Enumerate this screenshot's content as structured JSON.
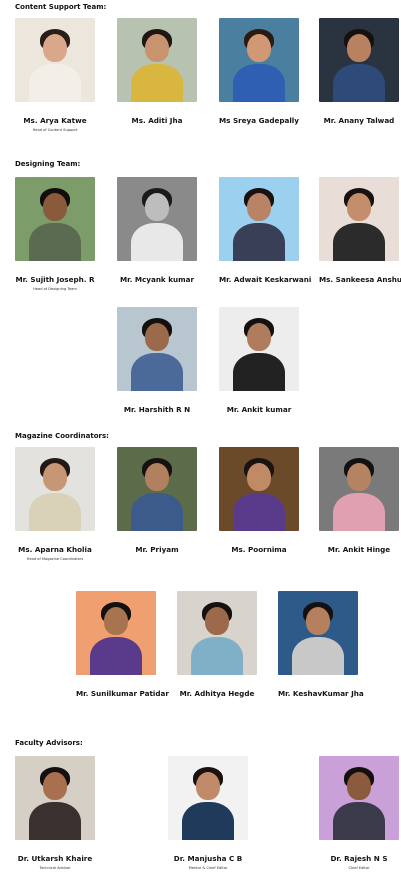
{
  "sections": {
    "content_support": {
      "title": "Content Support Team:",
      "members": [
        {
          "name": "Ms. Arya Katwe",
          "role": "Head of Content Support",
          "bg": "#ece6dd",
          "skin": "#d9a88b",
          "hair": "#2a1c16",
          "shirt": "#f2efe9"
        },
        {
          "name": "Ms. Aditi Jha",
          "role": "",
          "bg": "#b7c2b0",
          "skin": "#c8946f",
          "hair": "#1e1713",
          "shirt": "#d9b640"
        },
        {
          "name": "Ms Sreya Gadepally",
          "role": "",
          "bg": "#4a7fa0",
          "skin": "#d09874",
          "hair": "#2b1a12",
          "shirt": "#2f5fb3"
        },
        {
          "name": "Mr. Anany Talwad",
          "role": "",
          "bg": "#2a3340",
          "skin": "#b88160",
          "hair": "#15110f",
          "shirt": "#2d4a78"
        }
      ]
    },
    "designing": {
      "title": "Designing Team:",
      "members": [
        {
          "name": "Mr. Sujith Joseph. R",
          "role": "Head of Designing Team",
          "bg": "#7c9c6a",
          "skin": "#8a5a3c",
          "hair": "#120e0c",
          "shirt": "#5b6b52"
        },
        {
          "name": "Mr. Mcyank kumar",
          "role": "",
          "bg": "#8a8a8a",
          "skin": "#bdbdbd",
          "hair": "#1a1a1a",
          "shirt": "#e8e8e8"
        },
        {
          "name": "Mr. Adwait Keskarwani",
          "role": "",
          "bg": "#9bd0ef",
          "skin": "#b98466",
          "hair": "#181210",
          "shirt": "#3a3f58"
        },
        {
          "name": "Ms. Sankeesa Anshu",
          "role": "",
          "bg": "#e9ddd8",
          "skin": "#c48d6c",
          "hair": "#1a1210",
          "shirt": "#2b2b2b"
        },
        {
          "name": "Mr. Harshith R N",
          "role": "",
          "bg": "#b8c6cf",
          "skin": "#9a6a4a",
          "hair": "#141010",
          "shirt": "#4b6a9a"
        },
        {
          "name": "Mr. Ankit kumar",
          "role": "",
          "bg": "#ededed",
          "skin": "#b07c5e",
          "hair": "#151110",
          "shirt": "#222222"
        }
      ]
    },
    "magazine": {
      "title": "Magazine Coordinators:",
      "members": [
        {
          "name": "Ms. Aparna Kholia",
          "role": "Head of Magazine Coordinators",
          "bg": "#e4e2de",
          "skin": "#c79674",
          "hair": "#231813",
          "shirt": "#d9d1b8"
        },
        {
          "name": "Mr. Priyam",
          "role": "",
          "bg": "#5c6b4a",
          "skin": "#b0805f",
          "hair": "#161210",
          "shirt": "#3d5b8a"
        },
        {
          "name": "Ms. Poornima",
          "role": "",
          "bg": "#6b4a2a",
          "skin": "#c08a66",
          "hair": "#1b1310",
          "shirt": "#5a3a8a"
        },
        {
          "name": "Mr. Ankit Hinge",
          "role": "",
          "bg": "#7a7a7a",
          "skin": "#b58262",
          "hair": "#141010",
          "shirt": "#e0a0b0"
        },
        {
          "name": "Mr. Sunilkumar Patidar",
          "role": "",
          "bg": "#f0a070",
          "skin": "#a8734f",
          "hair": "#141010",
          "shirt": "#5a3a8a"
        },
        {
          "name": "Mr. Adhitya Hegde",
          "role": "",
          "bg": "#d8d3cc",
          "skin": "#9c6a4a",
          "hair": "#151110",
          "shirt": "#7fb0c8"
        },
        {
          "name": "Mr. KeshavKumar Jha",
          "role": "",
          "bg": "#2e5a8a",
          "skin": "#b4805e",
          "hair": "#151110",
          "shirt": "#c8c8c8"
        }
      ]
    },
    "faculty": {
      "title": "Faculty Advisors:",
      "members": [
        {
          "name": "Dr. Utkarsh Khaire",
          "role": "Technical Advisor",
          "bg": "#d6cfc6",
          "skin": "#a8704e",
          "hair": "#141010",
          "shirt": "#3a3030"
        },
        {
          "name": "Dr. Manjusha C B",
          "role": "Mentor & Chief Editor",
          "bg": "#f2f2f2",
          "skin": "#c08a68",
          "hair": "#1a1210",
          "shirt": "#1f3a5a"
        },
        {
          "name": "Dr. Rajesh N S",
          "role": "Chief Editor",
          "bg": "#c9a0d8",
          "skin": "#8c5a3c",
          "hair": "#141010",
          "shirt": "#3a3a4a"
        }
      ]
    }
  }
}
